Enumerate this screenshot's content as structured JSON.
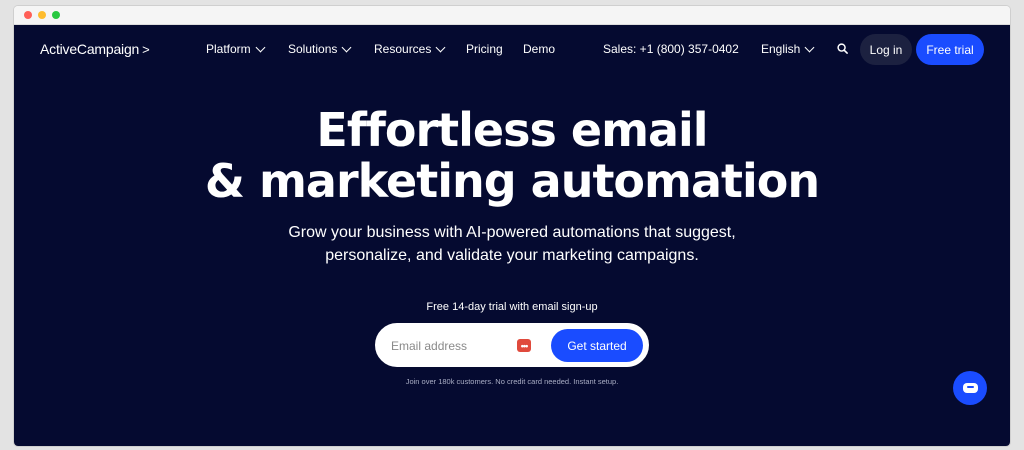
{
  "nav": {
    "logo": "ActiveCampaign",
    "logo_mark": ">",
    "links": [
      {
        "label": "Platform",
        "has_menu": true
      },
      {
        "label": "Solutions",
        "has_menu": true
      },
      {
        "label": "Resources",
        "has_menu": true
      },
      {
        "label": "Pricing",
        "has_menu": false
      },
      {
        "label": "Demo",
        "has_menu": false
      }
    ],
    "sales": "Sales: +1 (800) 357-0402",
    "language": "English",
    "login_label": "Log in",
    "trial_label": "Free trial"
  },
  "hero": {
    "title_line1": "Effortless email",
    "title_line2": "& marketing automation",
    "subtitle_line1": "Grow your business with AI-powered automations that suggest,",
    "subtitle_line2": "personalize, and validate your marketing campaigns."
  },
  "signup": {
    "note": "Free 14-day trial with email sign-up",
    "email_placeholder": "Email address",
    "password_manager_icon": "•••",
    "button_label": "Get started",
    "fine_print": "Join over 180k customers. No credit card needed. Instant setup."
  },
  "colors": {
    "background": "#050a30",
    "accent": "#1a4cff",
    "login_bg": "#1c2140"
  },
  "icons": {
    "search": "search-icon",
    "chat": "chat-icon"
  }
}
